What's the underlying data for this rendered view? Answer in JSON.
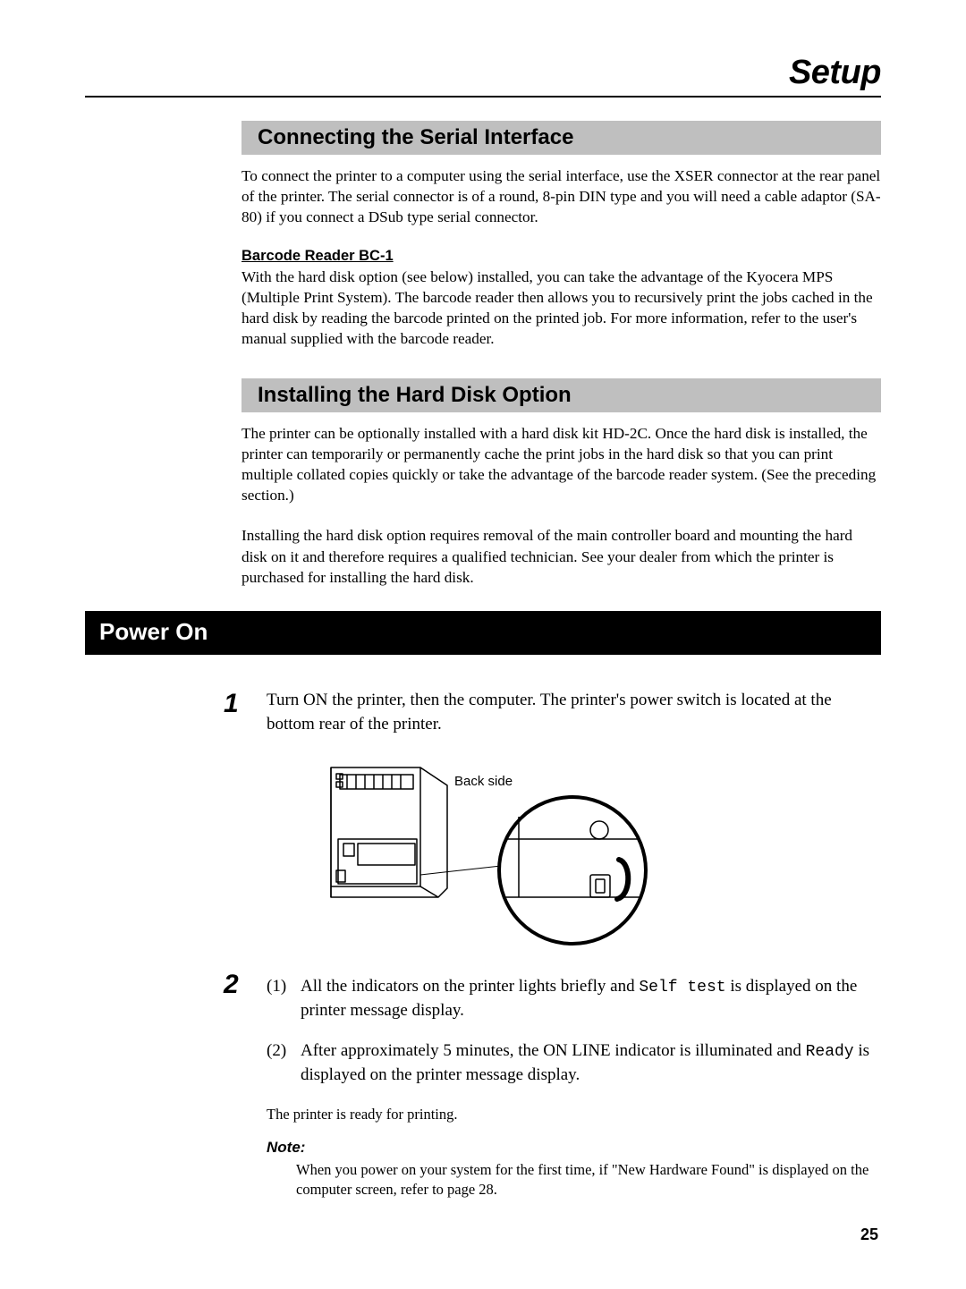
{
  "chapter_title": "Setup",
  "section1": {
    "heading": "Connecting the Serial Interface",
    "para1": "To connect the printer to a computer using the serial interface, use the XSER connector at the rear panel of the printer. The serial connector is of a round, 8-pin DIN type and you will need a cable adaptor (SA-80) if you connect a DSub type serial connector.",
    "subhead": "Barcode Reader BC-1",
    "para2": "With the hard disk option (see below) installed, you can take the advantage of the Kyocera MPS (Multiple Print System). The barcode reader then allows you to recursively print the jobs cached in the hard disk by reading the barcode printed on the printed job. For more information, refer to the user's manual supplied with the barcode reader."
  },
  "section2": {
    "heading": "Installing the Hard Disk Option",
    "para1": "The printer can be optionally installed with a hard disk kit HD-2C. Once the hard disk is installed, the printer can temporarily or permanently cache the print jobs in the hard disk so that you can print multiple collated copies quickly or take the advantage of the barcode reader system. (See the preceding section.)",
    "para2": "Installing the hard disk option requires removal of the main controller board and mounting the hard disk on it and therefore requires a qualified technician. See your dealer from which the printer is purchased for installing the hard disk."
  },
  "section3": {
    "heading": "Power On",
    "step1_num": "1",
    "step1_text": "Turn ON the printer, then the computer. The printer's power switch is located at the bottom rear of the printer.",
    "figure_label": "Back side",
    "step2_num": "2",
    "step2_1_mark": "(1)",
    "step2_1_a": "All the indicators on the printer lights briefly and ",
    "step2_1_code": "Self test",
    "step2_1_b": " is displayed on the printer message display.",
    "step2_2_mark": "(2)",
    "step2_2_a": "After approximately 5 minutes, the ON LINE indicator is illuminated and ",
    "step2_2_code": "Ready",
    "step2_2_b": " is displayed on the printer message display.",
    "ready_text": "The printer is ready for printing.",
    "note_label": "Note:",
    "note_body": "When you power on your system for the first time, if \"New Hardware Found\" is displayed on the computer screen, refer to page 28."
  },
  "page_number": "25"
}
